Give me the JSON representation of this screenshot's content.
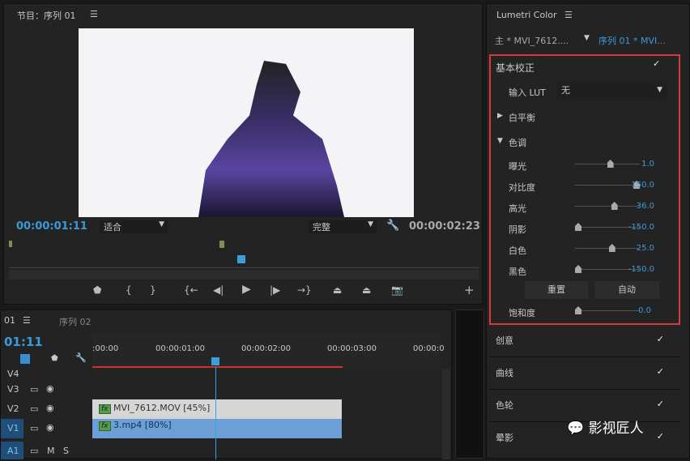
{
  "program_monitor": {
    "title": "节目：序列 01",
    "menu": "☰",
    "timecode_current": "00:00:01:11",
    "fit_label": "适合",
    "quality_label": "完整",
    "timecode_duration": "00:00:02:23",
    "controls": [
      "marker-icon",
      "mark-in-icon",
      "mark-out-icon",
      "go-to-in-icon",
      "step-back-icon",
      "play-icon",
      "step-forward-icon",
      "go-to-out-icon",
      "lift-icon",
      "extract-icon",
      "export-frame-icon",
      "add-icon"
    ],
    "playhead_fraction": 0.49
  },
  "timeline": {
    "tab_active": "01",
    "tab_menu": "☰",
    "tab_other": "序列 02",
    "timecode": "01:11",
    "ruler": [
      ":00:00",
      "00:00:01:00",
      "00:00:02:00",
      "00:00:03:00",
      "00:00:0"
    ],
    "tracks": [
      {
        "name": "V4"
      },
      {
        "name": "V3"
      },
      {
        "name": "V2"
      },
      {
        "name": "V1"
      },
      {
        "name": "A1",
        "m": "M",
        "s": "S"
      }
    ],
    "clips": [
      {
        "track": "V2",
        "label": "MVI_7612.MOV [45%]",
        "fx": "fx"
      },
      {
        "track": "V1",
        "label": "3.mp4 [80%]",
        "fx": "fx"
      }
    ]
  },
  "lumetri": {
    "title": "Lumetri Color",
    "menu": "☰",
    "master_clip": "主 * MVI_7612....",
    "sequence_clip": "序列 01 * MVI...",
    "basic": {
      "title": "基本校正",
      "check": "✓",
      "lut_label": "输入 LUT",
      "lut_value": "无",
      "white_balance": "白平衡",
      "tone": "色调",
      "sliders": [
        {
          "label": "曝光",
          "value": "1.0",
          "pos": 0.55
        },
        {
          "label": "对比度",
          "value": "150.0",
          "pos": 1.0
        },
        {
          "label": "高光",
          "value": "36.0",
          "pos": 0.62
        },
        {
          "label": "阴影",
          "value": "-150.0",
          "pos": 0.0
        },
        {
          "label": "白色",
          "value": "25.0",
          "pos": 0.58
        },
        {
          "label": "黑色",
          "value": "-150.0",
          "pos": 0.0
        }
      ],
      "reset": "重置",
      "auto": "自动",
      "saturation": {
        "label": "饱和度",
        "value": "0.0",
        "pos": 0.0
      }
    },
    "sections": [
      {
        "label": "创意",
        "check": "✓"
      },
      {
        "label": "曲线",
        "check": "✓"
      },
      {
        "label": "色轮",
        "check": "✓"
      },
      {
        "label": "晕影",
        "check": "✓"
      }
    ]
  },
  "watermark": "影视匠人"
}
